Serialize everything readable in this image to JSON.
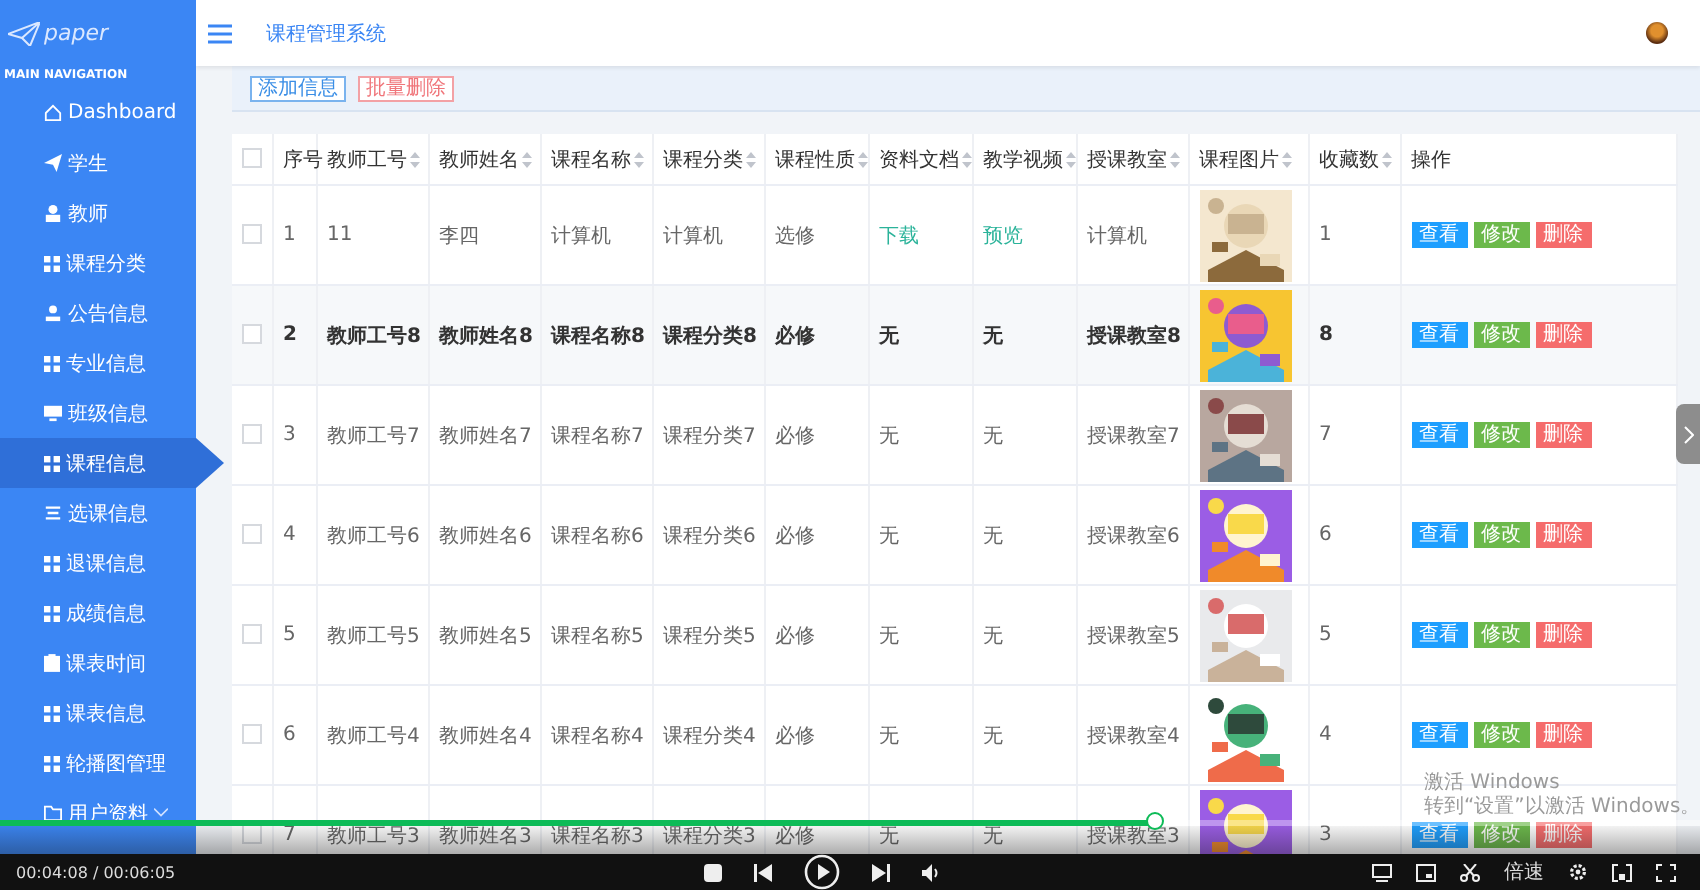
{
  "sidebar": {
    "logo": "paper",
    "section": "MAIN NAVIGATION",
    "items": [
      {
        "label": "Dashboard",
        "kind": "home",
        "selected": false
      },
      {
        "label": "学生",
        "kind": "send",
        "selected": false
      },
      {
        "label": "教师",
        "kind": "person",
        "selected": false
      },
      {
        "label": "课程分类",
        "kind": "grid",
        "selected": false
      },
      {
        "label": "公告信息",
        "kind": "user",
        "selected": false
      },
      {
        "label": "专业信息",
        "kind": "grid",
        "selected": false
      },
      {
        "label": "班级信息",
        "kind": "monitor",
        "selected": false
      },
      {
        "label": "课程信息",
        "kind": "grid",
        "selected": true
      },
      {
        "label": "选课信息",
        "kind": "list",
        "selected": false
      },
      {
        "label": "退课信息",
        "kind": "grid",
        "selected": false
      },
      {
        "label": "成绩信息",
        "kind": "grid",
        "selected": false
      },
      {
        "label": "课表时间",
        "kind": "clipboard",
        "selected": false
      },
      {
        "label": "课表信息",
        "kind": "grid",
        "selected": false
      },
      {
        "label": "轮播图管理",
        "kind": "grid",
        "selected": false
      },
      {
        "label": "用户资料",
        "kind": "folder",
        "selected": false,
        "expanded": false
      }
    ]
  },
  "header": {
    "title": "课程管理系统"
  },
  "toolbar": {
    "buttons": [
      {
        "label": "添加信息",
        "kind": "add"
      },
      {
        "label": "批量删除",
        "kind": "delete"
      }
    ]
  },
  "table": {
    "select_all": {
      "checked": false
    },
    "columns": [
      {
        "kind": "text",
        "label": "序号",
        "sortable": false
      },
      {
        "kind": "text",
        "label": "教师工号",
        "sortable": true
      },
      {
        "kind": "text",
        "label": "教师姓名",
        "sortable": true
      },
      {
        "kind": "text",
        "label": "课程名称",
        "sortable": true
      },
      {
        "kind": "text",
        "label": "课程分类",
        "sortable": true
      },
      {
        "kind": "text",
        "label": "课程性质",
        "sortable": true
      },
      {
        "kind": "text",
        "label": "资料文档",
        "sortable": true
      },
      {
        "kind": "text",
        "label": "教学视频",
        "sortable": true
      },
      {
        "kind": "text",
        "label": "授课教室",
        "sortable": true
      },
      {
        "kind": "picture",
        "label": "课程图片",
        "sortable": true
      },
      {
        "kind": "text",
        "label": "收藏数",
        "sortable": true
      },
      {
        "kind": "actions",
        "label": "操作",
        "sortable": false
      }
    ],
    "rows": [
      {
        "checked": false,
        "hovered": false,
        "files_linked": true,
        "cells": [
          "1",
          "11",
          "李四",
          "计算机",
          "计算机",
          "选修",
          "下载",
          "预览",
          "计算机",
          {
            "kind": "picture"
          },
          "1",
          {
            "kind": "actions",
            "buttons": [
              "查看",
              "修改",
              "删除"
            ]
          }
        ]
      },
      {
        "checked": false,
        "hovered": true,
        "files_linked": false,
        "cells": [
          "2",
          "教师工号8",
          "教师姓名8",
          "课程名称8",
          "课程分类8",
          "必修",
          "无",
          "无",
          "授课教室8",
          {
            "kind": "picture"
          },
          "8",
          {
            "kind": "actions",
            "buttons": [
              "查看",
              "修改",
              "删除"
            ]
          }
        ]
      },
      {
        "checked": false,
        "hovered": false,
        "files_linked": false,
        "cells": [
          "3",
          "教师工号7",
          "教师姓名7",
          "课程名称7",
          "课程分类7",
          "必修",
          "无",
          "无",
          "授课教室7",
          {
            "kind": "picture"
          },
          "7",
          {
            "kind": "actions",
            "buttons": [
              "查看",
              "修改",
              "删除"
            ]
          }
        ]
      },
      {
        "checked": false,
        "hovered": false,
        "files_linked": false,
        "cells": [
          "4",
          "教师工号6",
          "教师姓名6",
          "课程名称6",
          "课程分类6",
          "必修",
          "无",
          "无",
          "授课教室6",
          {
            "kind": "picture"
          },
          "6",
          {
            "kind": "actions",
            "buttons": [
              "查看",
              "修改",
              "删除"
            ]
          }
        ]
      },
      {
        "checked": false,
        "hovered": false,
        "files_linked": false,
        "cells": [
          "5",
          "教师工号5",
          "教师姓名5",
          "课程名称5",
          "课程分类5",
          "必修",
          "无",
          "无",
          "授课教室5",
          {
            "kind": "picture"
          },
          "5",
          {
            "kind": "actions",
            "buttons": [
              "查看",
              "修改",
              "删除"
            ]
          }
        ]
      },
      {
        "checked": false,
        "hovered": false,
        "files_linked": false,
        "cells": [
          "6",
          "教师工号4",
          "教师姓名4",
          "课程名称4",
          "课程分类4",
          "必修",
          "无",
          "无",
          "授课教室4",
          {
            "kind": "picture"
          },
          "4",
          {
            "kind": "actions",
            "buttons": [
              "查看",
              "修改",
              "删除"
            ]
          }
        ]
      },
      {
        "checked": false,
        "hovered": false,
        "files_linked": false,
        "cells": [
          "7",
          "教师工号3",
          "教师姓名3",
          "课程名称3",
          "课程分类3",
          "必修",
          "无",
          "无",
          "授课教室3",
          {
            "kind": "picture"
          },
          "3",
          {
            "kind": "actions",
            "buttons": [
              "查看",
              "修改",
              "删除"
            ]
          }
        ]
      }
    ]
  },
  "os_notice": {
    "title": "激活 Windows",
    "message": "转到“设置”以激活 Windows。"
  },
  "player": {
    "progress": {
      "level": 0.68
    },
    "time": "00:04:08 / 00:06:05",
    "playing": false,
    "speed_label": "倍速"
  }
}
